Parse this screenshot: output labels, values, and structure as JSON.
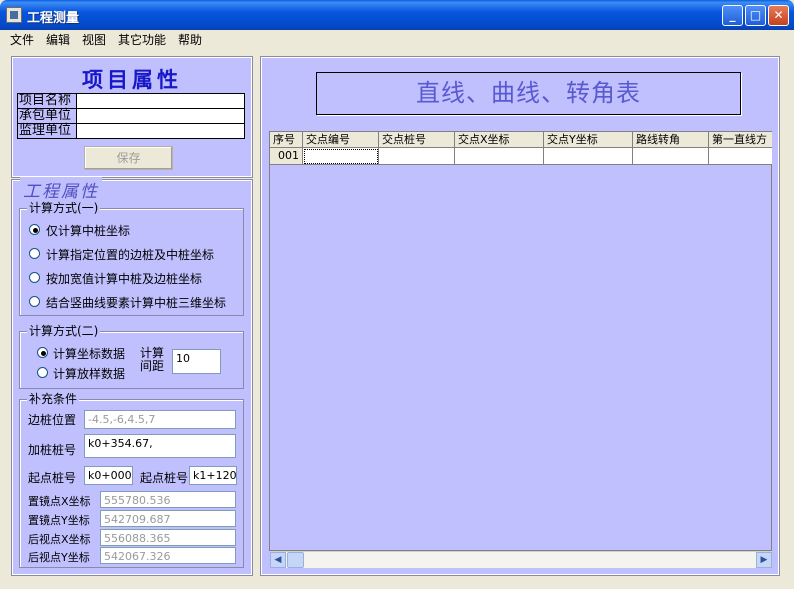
{
  "window": {
    "title": "工程测量"
  },
  "menu": [
    "文件",
    "编辑",
    "视图",
    "其它功能",
    "帮助"
  ],
  "project": {
    "heading": "项目属性",
    "fields": [
      {
        "label": "项目名称",
        "value": ""
      },
      {
        "label": "承包单位",
        "value": ""
      },
      {
        "label": "监理单位",
        "value": ""
      }
    ],
    "save_label": "保存"
  },
  "engineering": {
    "heading": "工程属性",
    "method1": {
      "legend": "计算方式(一)",
      "options": [
        {
          "label": "仅计算中桩坐标",
          "checked": true
        },
        {
          "label": "计算指定位置的边桩及中桩坐标",
          "checked": false
        },
        {
          "label": "按加宽值计算中桩及边桩坐标",
          "checked": false
        },
        {
          "label": "结合竖曲线要素计算中桩三维坐标",
          "checked": false
        }
      ]
    },
    "method2": {
      "legend": "计算方式(二)",
      "options": [
        {
          "label": "计算坐标数据",
          "checked": true
        },
        {
          "label": "计算放样数据",
          "checked": false
        }
      ],
      "interval_label_1": "计算",
      "interval_label_2": "间距",
      "interval_value": "10"
    },
    "supplement": {
      "legend": "补充条件",
      "side_pile_label": "边桩位置",
      "side_pile_value": "-4.5,-6,4.5,7",
      "add_pile_label": "加桩桩号",
      "add_pile_value": "k0+354.67,",
      "start_label": "起点桩号",
      "start_value": "k0+000",
      "end_label": "起点桩号",
      "end_value": "k1+120",
      "station_x_label": "置镜点X坐标",
      "station_x_value": "555780.536",
      "station_y_label": "置镜点Y坐标",
      "station_y_value": "542709.687",
      "back_x_label": "后视点X坐标",
      "back_x_value": "556088.365",
      "back_y_label": "后视点Y坐标",
      "back_y_value": "542067.326"
    }
  },
  "table": {
    "title": "直线、曲线、转角表",
    "columns": [
      "序号",
      "交点编号",
      "交点桩号",
      "交点X坐标",
      "交点Y坐标",
      "路线转角",
      "第一直线方"
    ],
    "rows": [
      [
        "001",
        "",
        "",
        "",
        "",
        "",
        ""
      ]
    ]
  },
  "colors": {
    "panel": "#c0c0ff",
    "title_text": "#5a5ad0",
    "heading_text": "#1818c8"
  }
}
